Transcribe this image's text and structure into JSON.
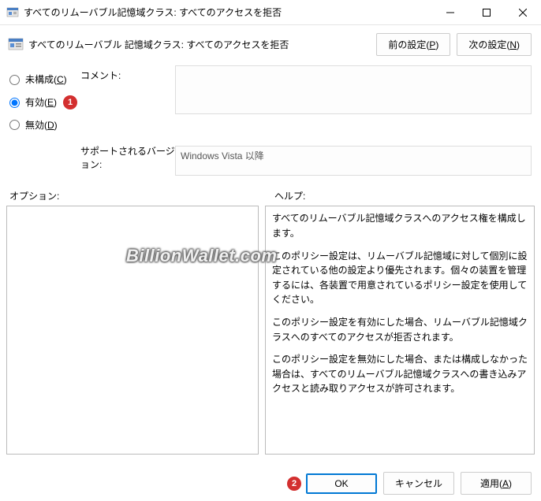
{
  "window": {
    "title": "すべてのリムーバブル記憶域クラス: すべてのアクセスを拒否"
  },
  "header": {
    "title": "すべてのリムーバブル 記憶域クラス: すべてのアクセスを拒否",
    "prev_btn": "前の設定(",
    "prev_key": "P",
    "next_btn": "次の設定(",
    "next_key": "N",
    "paren_close": ")"
  },
  "radios": {
    "not_configured": "未構成(",
    "not_configured_key": "C",
    "enabled": "有効(",
    "enabled_key": "E",
    "disabled": "無効(",
    "disabled_key": "D",
    "paren_close": ")"
  },
  "labels": {
    "comment": "コメント:",
    "supported": "サポートされるバージョン:",
    "options": "オプション:",
    "help": "ヘルプ:"
  },
  "fields": {
    "comment": "",
    "supported": "Windows Vista 以降"
  },
  "help": {
    "p1": "すべてのリムーバブル記憶域クラスへのアクセス権を構成します。",
    "p2": "このポリシー設定は、リムーバブル記憶域に対して個別に設定されている他の設定より優先されます。個々の装置を管理するには、各装置で用意されているポリシー設定を使用してください。",
    "p3": "このポリシー設定を有効にした場合、リムーバブル記憶域クラスへのすべてのアクセスが拒否されます。",
    "p4": "このポリシー設定を無効にした場合、または構成しなかった場合は、すべてのリムーバブル記憶域クラスへの書き込みアクセスと読み取りアクセスが許可されます。"
  },
  "footer": {
    "ok": "OK",
    "cancel": "キャンセル",
    "apply": "適用(",
    "apply_key": "A",
    "paren_close": ")"
  },
  "annotations": {
    "badge1": "1",
    "badge2": "2"
  },
  "watermark": "BillionWallet.com"
}
